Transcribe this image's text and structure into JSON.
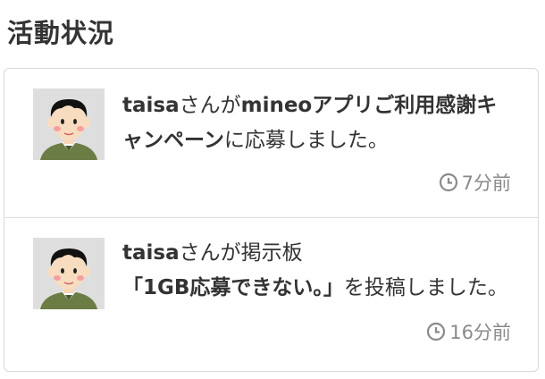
{
  "section": {
    "title": "活動状況"
  },
  "activities": [
    {
      "user": "taisa",
      "text_1": "さんが",
      "target": "mineoアプリご利用感謝キャンペーン",
      "text_2": "に応募しました。",
      "time": "7分前",
      "avatar_icon": "user-avatar-icon"
    },
    {
      "user": "taisa",
      "text_1": "さんが掲示板",
      "target": "「1GB応募できない。」",
      "text_2": "を投稿しました。",
      "time": "16分前",
      "avatar_icon": "user-avatar-icon"
    }
  ],
  "colors": {
    "text": "#333333",
    "meta": "#8a8a8a",
    "border": "#d9d9d9",
    "avatar_bg": "#dedede",
    "shirt": "#6b7d45"
  },
  "icons": {
    "timestamp": "clock-icon"
  }
}
